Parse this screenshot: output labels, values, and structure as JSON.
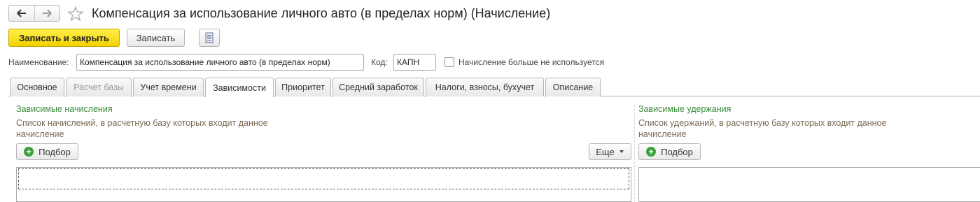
{
  "window": {
    "title": "Компенсация за использование личного авто (в пределах норм) (Начисление)"
  },
  "icons": {
    "back": "arrow-left-icon",
    "forward": "arrow-right-icon",
    "favorite": "star-icon",
    "document": "document-icon",
    "add": "plus-circle-icon",
    "dropdown": "triangle-down-icon"
  },
  "toolbar": {
    "save_close_label": "Записать и закрыть",
    "save_label": "Записать"
  },
  "fields": {
    "name_label": "Наименование:",
    "name_value": "Компенсация за использование личного авто (в пределах норм)",
    "code_label": "Код:",
    "code_value": "КАПН",
    "not_used_label": "Начисление больше не используется",
    "not_used_checked": false
  },
  "tabs": [
    {
      "label": "Основное",
      "state": "normal"
    },
    {
      "label": "Расчет базы",
      "state": "disabled"
    },
    {
      "label": "Учет времени",
      "state": "normal"
    },
    {
      "label": "Зависимости",
      "state": "active"
    },
    {
      "label": "Приоритет",
      "state": "normal"
    },
    {
      "label": "Средний заработок",
      "state": "normal"
    },
    {
      "label": "Налоги, взносы, бухучет",
      "state": "normal"
    },
    {
      "label": "Описание",
      "state": "normal"
    }
  ],
  "left_panel": {
    "title": "Зависимые начисления",
    "hint_line1": "Список начислений, в расчетную базу которых входит данное",
    "hint_line2": "начисление",
    "pick_label": "Подбор",
    "more_label": "Еще"
  },
  "right_panel": {
    "title": "Зависимые удержания",
    "hint_line1": "Список удержаний, в расчетную базу которых входит данное",
    "hint_line2": "начисление",
    "pick_label": "Подбор"
  },
  "colors": {
    "primary_button": "#f3d100",
    "section_title": "#3a8a3a",
    "hint_text": "#7a6a55",
    "add_icon": "#3ba23b"
  }
}
